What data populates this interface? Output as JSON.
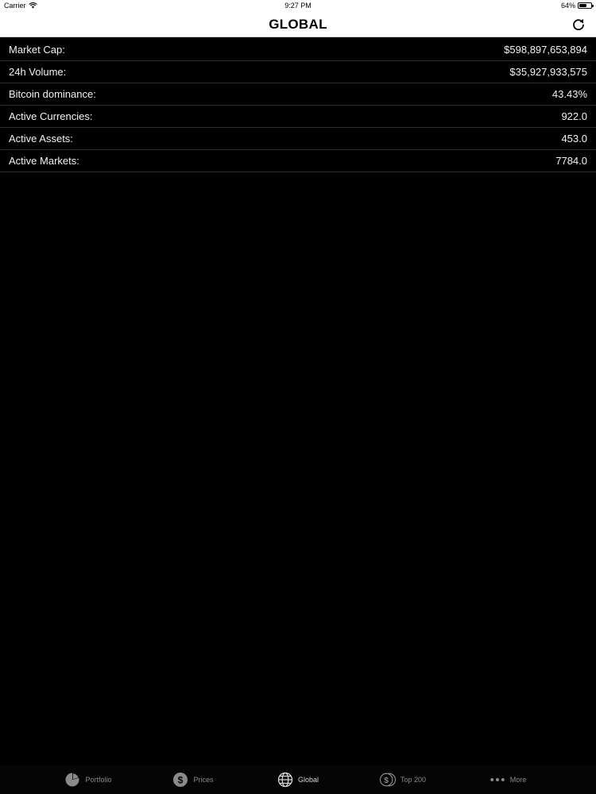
{
  "status_bar": {
    "carrier": "Carrier",
    "time": "9:27 PM",
    "battery_percent": "64%",
    "battery_level": 0.64,
    "icons": [
      "wifi-icon",
      "battery-icon"
    ]
  },
  "nav": {
    "title": "GLOBAL",
    "refresh_icon": "refresh-icon"
  },
  "stats": [
    {
      "label": "Market Cap:",
      "value": "$598,897,653,894"
    },
    {
      "label": "24h Volume:",
      "value": "$35,927,933,575"
    },
    {
      "label": "Bitcoin dominance:",
      "value": "43.43%"
    },
    {
      "label": "Active Currencies:",
      "value": "922.0"
    },
    {
      "label": "Active Assets:",
      "value": "453.0"
    },
    {
      "label": "Active Markets:",
      "value": "7784.0"
    }
  ],
  "tabs": [
    {
      "label": "Portfolio",
      "icon": "pie-chart-icon"
    },
    {
      "label": "Prices",
      "icon": "dollar-icon"
    },
    {
      "label": "Global",
      "icon": "globe-icon",
      "active": true
    },
    {
      "label": "Top 200",
      "icon": "coins-icon"
    },
    {
      "label": "More",
      "icon": "more-icon"
    }
  ],
  "colors": {
    "background": "#000000",
    "nav_background": "#ffffff",
    "row_text": "#f2f2f2",
    "tab_inactive": "#8a8a8a"
  }
}
